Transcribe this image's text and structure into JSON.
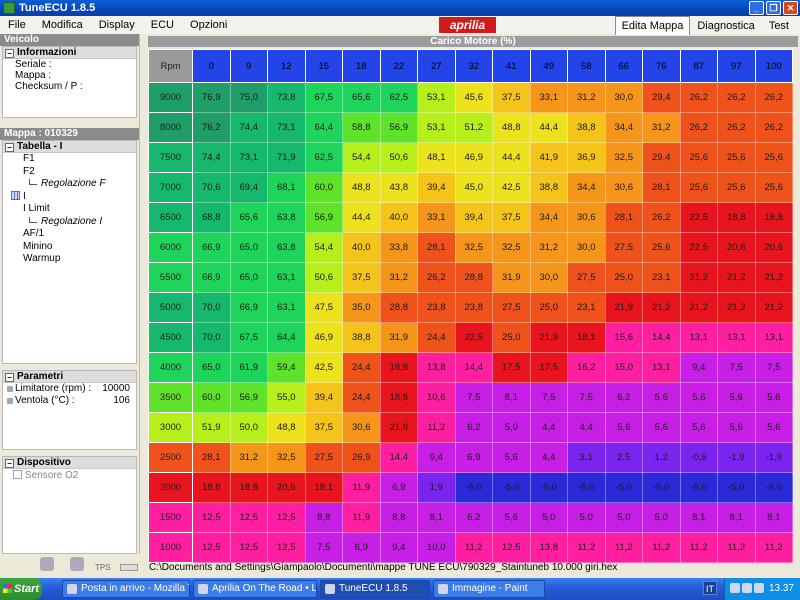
{
  "window": {
    "title": "TuneECU 1.8.5",
    "controls": [
      "_",
      "❐",
      "✕"
    ]
  },
  "menu": [
    "File",
    "Modifica",
    "Display",
    "ECU",
    "Opzioni"
  ],
  "logo": "aprilia",
  "tabs": [
    "Edita Mappa",
    "Diagnostica",
    "Test"
  ],
  "left": {
    "veicolo": {
      "header": "Veicolo",
      "section": "Informazioni",
      "lines": [
        "Seriale :",
        "Mappa :",
        "Checksum / P :"
      ]
    },
    "mappa": {
      "header": "Mappa : 010329",
      "section": "Tabella - I",
      "items": [
        {
          "label": "F1",
          "kind": "item"
        },
        {
          "label": "F2",
          "kind": "item"
        },
        {
          "label": "Regolazione F",
          "kind": "sub"
        },
        {
          "label": "I",
          "kind": "selected"
        },
        {
          "label": "I Limit",
          "kind": "item"
        },
        {
          "label": "Regolazione I",
          "kind": "sub"
        },
        {
          "label": "AF/1",
          "kind": "item"
        },
        {
          "label": "Minino",
          "kind": "item"
        },
        {
          "label": "Warmup",
          "kind": "item"
        }
      ]
    },
    "parametri": {
      "section": "Parametri",
      "rows": [
        {
          "k": "Limitatore (rpm) :",
          "v": "10000"
        },
        {
          "k": "Ventola (°C) :",
          "v": "106"
        }
      ]
    },
    "dispositivo": {
      "section": "Dispositivo",
      "checkbox": "Sensore O2"
    }
  },
  "grid": {
    "title": "Carico Motore (%)",
    "corner": "Rpm",
    "columns": [
      "0",
      "9",
      "12",
      "15",
      "18",
      "22",
      "27",
      "32",
      "41",
      "49",
      "58",
      "66",
      "76",
      "87",
      "97",
      "100"
    ],
    "rows": [
      {
        "rpm": "9000",
        "values": [
          "76,9",
          "75,0",
          "73,8",
          "67,5",
          "65,6",
          "62,5",
          "53,1",
          "45,6",
          "37,5",
          "33,1",
          "31,2",
          "30,0",
          "29,4",
          "26,2",
          "26,2",
          "26,2"
        ]
      },
      {
        "rpm": "8000",
        "values": [
          "76,2",
          "74,4",
          "73,1",
          "64,4",
          "58,8",
          "56,9",
          "53,1",
          "51,2",
          "48,8",
          "44,4",
          "38,8",
          "34,4",
          "31,2",
          "26,2",
          "26,2",
          "26,2"
        ]
      },
      {
        "rpm": "7500",
        "values": [
          "74,4",
          "73,1",
          "71,9",
          "62,5",
          "54,4",
          "50,6",
          "48,1",
          "46,9",
          "44,4",
          "41,9",
          "36,9",
          "32,5",
          "29,4",
          "25,6",
          "25,6",
          "25,6"
        ]
      },
      {
        "rpm": "7000",
        "values": [
          "70,6",
          "69,4",
          "68,1",
          "60,0",
          "48,8",
          "43,8",
          "39,4",
          "45,0",
          "42,5",
          "38,8",
          "34,4",
          "30,6",
          "28,1",
          "25,6",
          "25,6",
          "25,6"
        ]
      },
      {
        "rpm": "6500",
        "values": [
          "68,8",
          "65,6",
          "63,8",
          "56,9",
          "44,4",
          "40,0",
          "33,1",
          "39,4",
          "37,5",
          "34,4",
          "30,6",
          "28,1",
          "26,2",
          "22,5",
          "18,8",
          "18,8"
        ]
      },
      {
        "rpm": "6000",
        "values": [
          "66,9",
          "65,0",
          "63,8",
          "54,4",
          "40,0",
          "33,8",
          "28,1",
          "32,5",
          "32,5",
          "31,2",
          "30,0",
          "27,5",
          "25,6",
          "22,5",
          "20,6",
          "20,6"
        ]
      },
      {
        "rpm": "5500",
        "values": [
          "66,9",
          "65,0",
          "63,1",
          "50,6",
          "37,5",
          "31,2",
          "26,2",
          "28,8",
          "31,9",
          "30,0",
          "27,5",
          "25,0",
          "23,1",
          "21,2",
          "21,2",
          "21,2"
        ]
      },
      {
        "rpm": "5000",
        "values": [
          "70,0",
          "66,9",
          "63,1",
          "47,5",
          "35,0",
          "28,8",
          "23,8",
          "23,8",
          "27,5",
          "25,0",
          "23,1",
          "21,9",
          "21,2",
          "21,2",
          "21,2",
          "21,2"
        ]
      },
      {
        "rpm": "4500",
        "values": [
          "70,0",
          "67,5",
          "64,4",
          "46,9",
          "38,8",
          "31,9",
          "24,4",
          "22,5",
          "25,0",
          "21,9",
          "18,1",
          "15,6",
          "14,4",
          "13,1",
          "13,1",
          "13,1"
        ]
      },
      {
        "rpm": "4000",
        "values": [
          "65,0",
          "61,9",
          "59,4",
          "42,5",
          "24,4",
          "18,8",
          "13,8",
          "14,4",
          "17,5",
          "17,5",
          "16,2",
          "15,0",
          "13,1",
          "9,4",
          "7,5",
          "7,5"
        ]
      },
      {
        "rpm": "3500",
        "values": [
          "60,0",
          "56,9",
          "55,0",
          "39,4",
          "24,4",
          "18,8",
          "10,6",
          "7,5",
          "8,1",
          "7,5",
          "7,5",
          "6,2",
          "5,6",
          "5,6",
          "5,6",
          "5,6"
        ]
      },
      {
        "rpm": "3000",
        "values": [
          "51,9",
          "50,0",
          "48,8",
          "37,5",
          "30,6",
          "21,9",
          "11,2",
          "6,2",
          "5,0",
          "4,4",
          "4,4",
          "5,6",
          "5,6",
          "5,6",
          "5,6",
          "5,6"
        ]
      },
      {
        "rpm": "2500",
        "values": [
          "28,1",
          "31,2",
          "32,5",
          "27,5",
          "26,9",
          "14,4",
          "9,4",
          "6,9",
          "5,6",
          "4,4",
          "3,1",
          "2,5",
          "1,2",
          "-0,6",
          "-1,9",
          "-1,9"
        ]
      },
      {
        "rpm": "2000",
        "values": [
          "18,8",
          "18,8",
          "20,6",
          "18,1",
          "11,9",
          "6,9",
          "1,9",
          "-5,0",
          "-5,0",
          "-5,0",
          "-5,0",
          "-5,0",
          "-5,0",
          "-5,0",
          "-5,0",
          "-5,0"
        ]
      },
      {
        "rpm": "1500",
        "values": [
          "12,5",
          "12,5",
          "12,5",
          "8,8",
          "11,9",
          "8,8",
          "8,1",
          "6,2",
          "5,6",
          "5,0",
          "5,0",
          "5,0",
          "5,0",
          "8,1",
          "8,1",
          "8,1"
        ]
      },
      {
        "rpm": "1000",
        "values": [
          "12,5",
          "12,5",
          "12,5",
          "7,5",
          "6,9",
          "9,4",
          "10,0",
          "11,2",
          "12,5",
          "13,8",
          "11,2",
          "11,2",
          "11,2",
          "11,2",
          "11,2",
          "11,2"
        ]
      }
    ],
    "colors": {
      "header": "#2244e8",
      "rpm_header": "#aaaaaa",
      "scale": [
        "#2a2ad8",
        "#7c24ef",
        "#c81fe6",
        "#ff1fa0",
        "#e8141e",
        "#f0521c",
        "#f5961a",
        "#f4c41a",
        "#ede21e",
        "#b7ef1c",
        "#5fe22a",
        "#1fd45a",
        "#16b86d",
        "#1f9e6a"
      ]
    }
  },
  "status": {
    "tps_label": "TPS",
    "path": "C:\\Documents and Settings\\Giampaolo\\Documenti\\mappe TUNE ECU\\790329_Staintuneb  10.000 giri.hex"
  },
  "taskbar": {
    "start": "Start",
    "tasks": [
      "Posta in arrivo - Mozilla T...",
      "Aprilia On The Road • Le...",
      "TuneECU 1.8.5",
      "Immagine - Paint"
    ],
    "lang": "IT",
    "clock": "13.37"
  }
}
